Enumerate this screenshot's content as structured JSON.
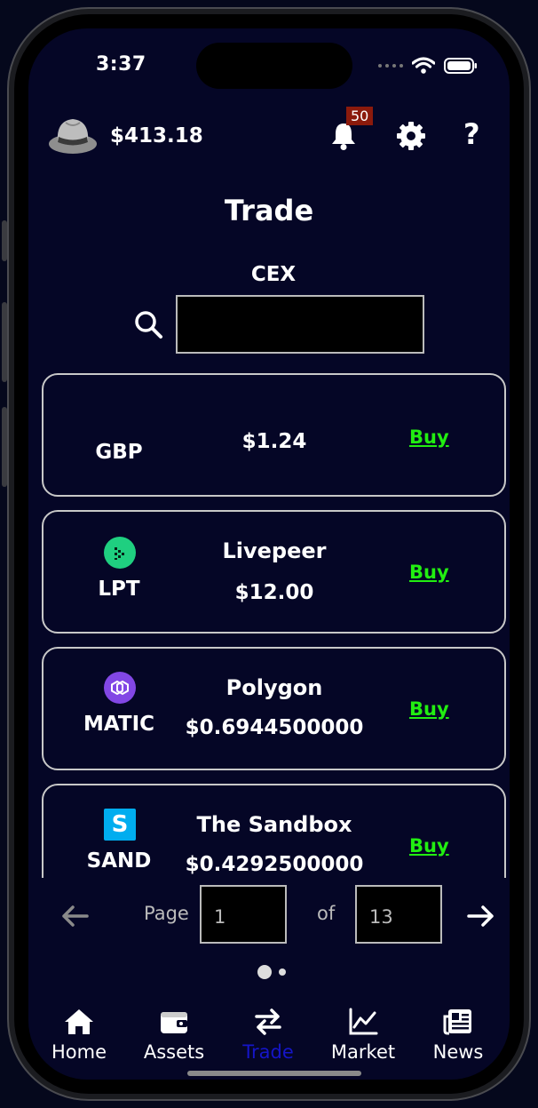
{
  "status_bar": {
    "time": "3:37"
  },
  "header": {
    "balance": "$413.18",
    "notification_count": "50",
    "help_label": "?"
  },
  "page": {
    "title": "Trade",
    "subtitle": "CEX"
  },
  "search": {
    "value": "",
    "placeholder": ""
  },
  "assets": [
    {
      "symbol": "GBP",
      "name": "",
      "price": "$1.24",
      "buy_label": "Buy",
      "icon": "none"
    },
    {
      "symbol": "LPT",
      "name": "Livepeer",
      "price": "$12.00",
      "buy_label": "Buy",
      "icon": "livepeer-icon"
    },
    {
      "symbol": "MATIC",
      "name": "Polygon",
      "price": "$0.6944500000",
      "buy_label": "Buy",
      "icon": "polygon-icon"
    },
    {
      "symbol": "SAND",
      "name": "The Sandbox",
      "price": "$0.4292500000",
      "buy_label": "Buy",
      "icon": "sandbox-icon"
    }
  ],
  "pager": {
    "page_label": "Page",
    "current_page": "1",
    "of_label": "of",
    "total_pages": "13"
  },
  "tabs": [
    {
      "label": "Home",
      "icon": "home-icon",
      "active": false
    },
    {
      "label": "Assets",
      "icon": "wallet-icon",
      "active": false
    },
    {
      "label": "Trade",
      "icon": "swap-arrows-icon",
      "active": true
    },
    {
      "label": "Market",
      "icon": "chart-icon",
      "active": false
    },
    {
      "label": "News",
      "icon": "newspaper-icon",
      "active": false
    }
  ],
  "colors": {
    "background": "#050626",
    "buy": "#22ee11",
    "active_tab": "#1515c8",
    "badge": "#8b1a0c"
  }
}
